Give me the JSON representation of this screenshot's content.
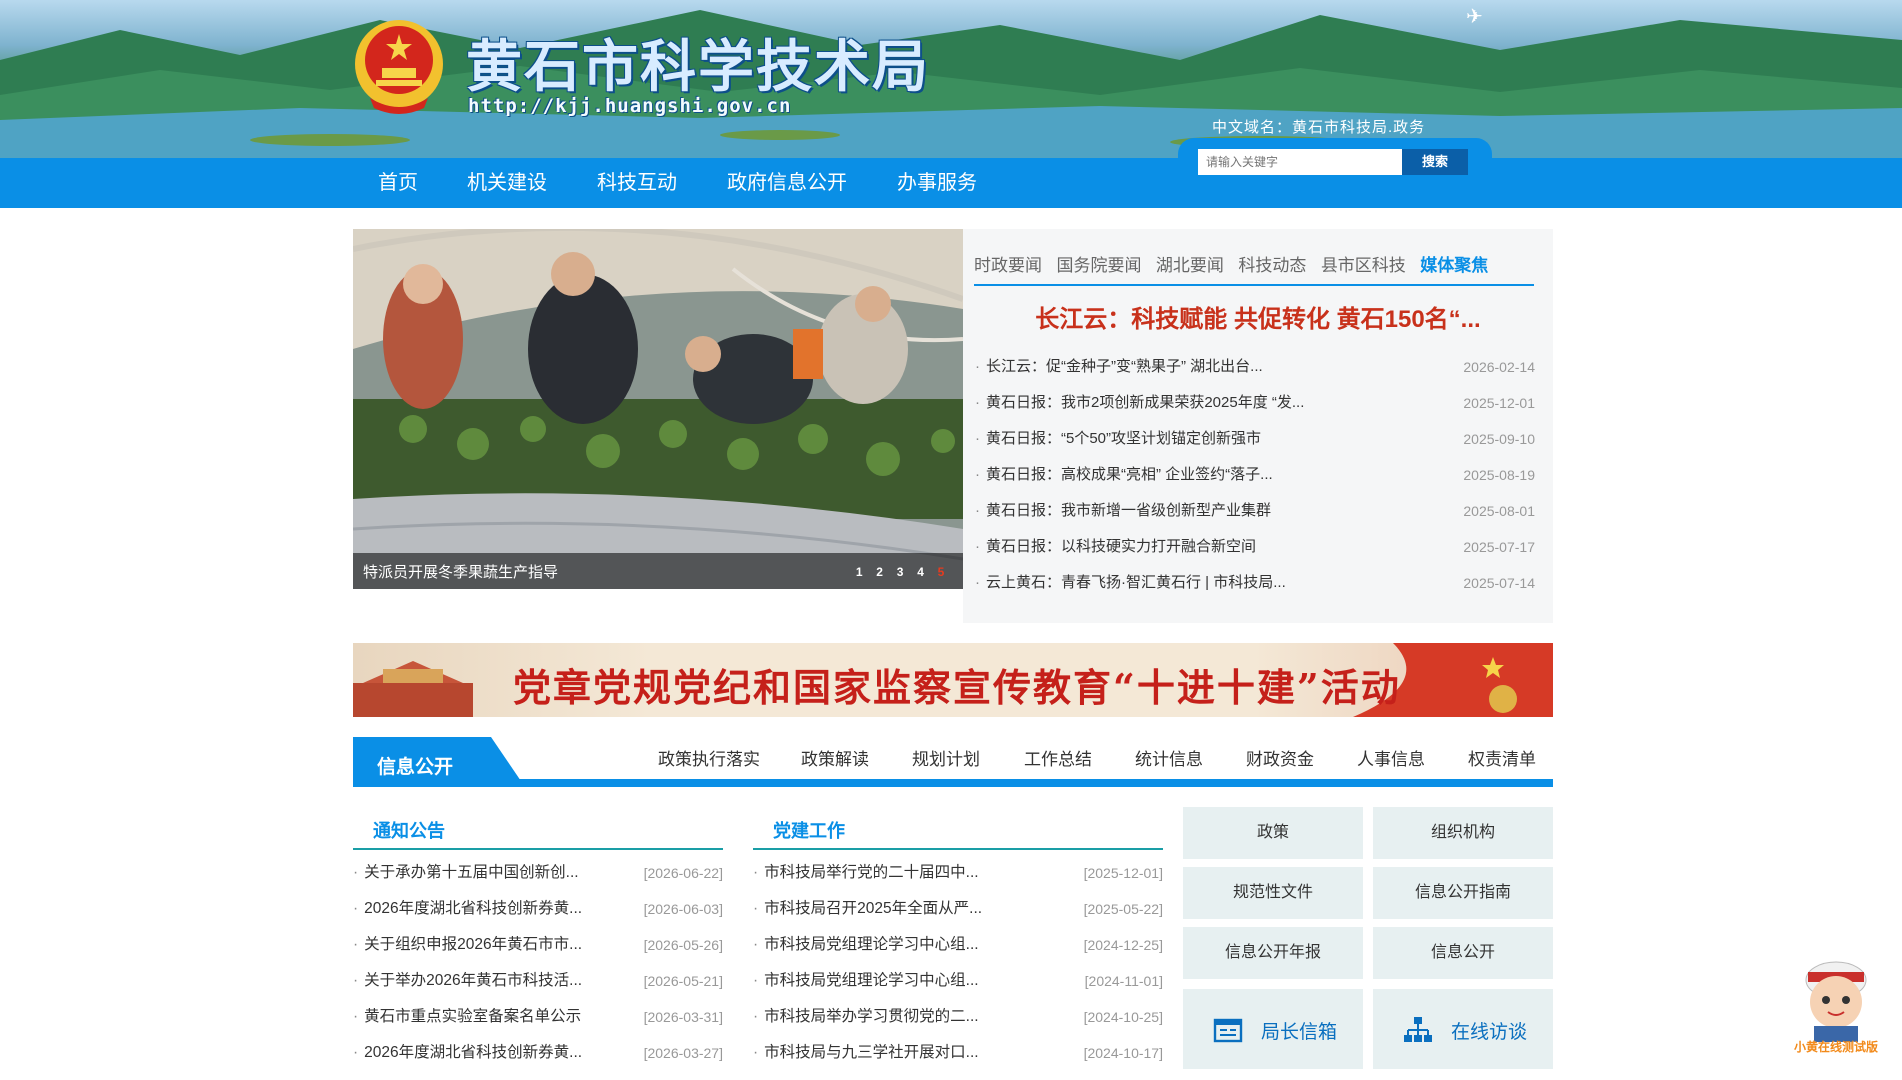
{
  "header": {
    "site_title": "黄石市科学技术局",
    "site_url": "http://kjj.huangshi.gov.cn",
    "cn_domain": "中文域名：黄石市科技局.政务"
  },
  "search": {
    "placeholder": "请输入关键字",
    "button_label": "搜索"
  },
  "nav": {
    "items": [
      "首页",
      "机关建设",
      "科技互动",
      "政府信息公开",
      "办事服务"
    ]
  },
  "slider": {
    "caption": "特派员开展冬季果蔬生产指导",
    "dots": [
      "1",
      "2",
      "3",
      "4",
      "5"
    ],
    "active_dot": 5
  },
  "news": {
    "tabs": [
      "时政要闻",
      "国务院要闻",
      "湖北要闻",
      "科技动态",
      "县市区科技",
      "媒体聚焦"
    ],
    "active_tab": "媒体聚焦",
    "headline": "长江云：科技赋能 共促转化 黄石150名“...",
    "items": [
      {
        "title": "长江云：促“金种子”变“熟果子” 湖北出台...",
        "date": "2026-02-14"
      },
      {
        "title": "黄石日报：我市2项创新成果荣获2025年度 “发...",
        "date": "2025-12-01"
      },
      {
        "title": "黄石日报：“5个50”攻坚计划锚定创新强市",
        "date": "2025-09-10"
      },
      {
        "title": "黄石日报：高校成果“亮相” 企业签约“落子...",
        "date": "2025-08-19"
      },
      {
        "title": "黄石日报：我市新增一省级创新型产业集群",
        "date": "2025-08-01"
      },
      {
        "title": "黄石日报：以科技硬实力打开融合新空间",
        "date": "2025-07-17"
      },
      {
        "title": "云上黄石：青春飞扬·智汇黄石行 | 市科技局...",
        "date": "2025-07-14"
      }
    ]
  },
  "banner": {
    "text": "党章党规党纪和国家监察宣传教育“十进十建”活动"
  },
  "info": {
    "title": "信息公开",
    "subnav": [
      "政策执行落实",
      "政策解读",
      "规划计划",
      "工作总结",
      "统计信息",
      "财政资金",
      "人事信息",
      "权责清单"
    ]
  },
  "notices": {
    "title": "通知公告",
    "items": [
      {
        "title": "关于承办第十五届中国创新创...",
        "date": "[2026-06-22]"
      },
      {
        "title": "2026年度湖北省科技创新券黄...",
        "date": "[2026-06-03]"
      },
      {
        "title": "关于组织申报2026年黄石市市...",
        "date": "[2026-05-26]"
      },
      {
        "title": "关于举办2026年黄石市科技活...",
        "date": "[2026-05-21]"
      },
      {
        "title": "黄石市重点实验室备案名单公示",
        "date": "[2026-03-31]"
      },
      {
        "title": "2026年度湖北省科技创新券黄...",
        "date": "[2026-03-27]"
      }
    ]
  },
  "party": {
    "title": "党建工作",
    "items": [
      {
        "title": "市科技局举行党的二十届四中...",
        "date": "[2025-12-01]"
      },
      {
        "title": "市科技局召开2025年全面从严...",
        "date": "[2025-05-22]"
      },
      {
        "title": "市科技局党组理论学习中心组...",
        "date": "[2024-12-25]"
      },
      {
        "title": "市科技局党组理论学习中心组...",
        "date": "[2024-11-01]"
      },
      {
        "title": "市科技局举办学习贯彻党的二...",
        "date": "[2024-10-25]"
      },
      {
        "title": "市科技局与九三学社开展对口...",
        "date": "[2024-10-17]"
      }
    ]
  },
  "quick_links": [
    "政策",
    "组织机构",
    "规范性文件",
    "信息公开指南",
    "信息公开年报",
    "信息公开"
  ],
  "big_links": [
    {
      "label": "局长信箱",
      "icon": "mailbox-icon"
    },
    {
      "label": "在线访谈",
      "icon": "org-chart-icon"
    }
  ],
  "mascot": {
    "caption": "小黄在线测试版"
  },
  "colors": {
    "primary": "#0a8fe6",
    "headline_red": "#c8311b",
    "teal_rule": "#1a9ea6",
    "tile_bg": "#e7f0f1"
  }
}
